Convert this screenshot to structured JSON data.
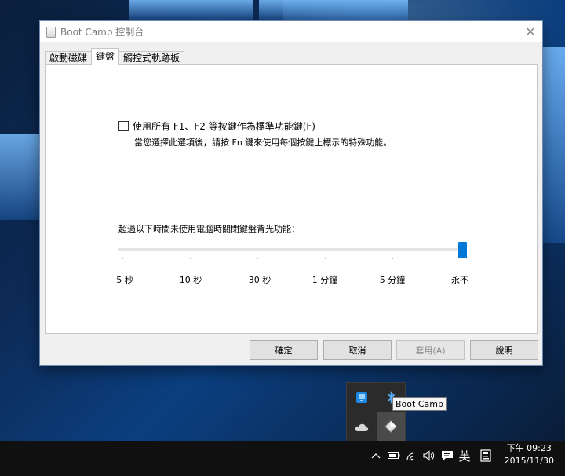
{
  "window": {
    "title": "Boot Camp 控制台",
    "close_glyph": "✕"
  },
  "tabs": [
    {
      "label": "啟動磁碟",
      "active": false
    },
    {
      "label": "鍵盤",
      "active": true
    },
    {
      "label": "觸控式軌跡板",
      "active": false
    }
  ],
  "keyboard": {
    "fn_checkbox_label": "使用所有 F1、F2 等按鍵作為標準功能鍵(F)",
    "fn_checkbox_checked": false,
    "fn_description": "當您選擇此選項後，請按 Fn 鍵來使用每個按鍵上標示的特殊功能。",
    "backlight_label": "超過以下時間未使用電腦時關閉鍵盤背光功能：",
    "backlight_options": [
      "5 秒",
      "10 秒",
      "30 秒",
      "1 分鐘",
      "5 分鐘",
      "永不"
    ],
    "backlight_selected": "永不"
  },
  "buttons": {
    "ok": "確定",
    "cancel": "取消",
    "apply": "套用(A)",
    "help": "說明"
  },
  "tray_flyout": {
    "tooltip": "Boot Camp",
    "icons": [
      "network-monitor-icon",
      "bluetooth-icon",
      "onedrive-cloud-icon",
      "bootcamp-diamond-icon"
    ]
  },
  "taskbar": {
    "show_hidden_glyph": "^",
    "ime_label": "英",
    "time": "下午 09:23",
    "date": "2015/11/30"
  },
  "colors": {
    "accent": "#0078d7",
    "taskbar": "#101010"
  }
}
